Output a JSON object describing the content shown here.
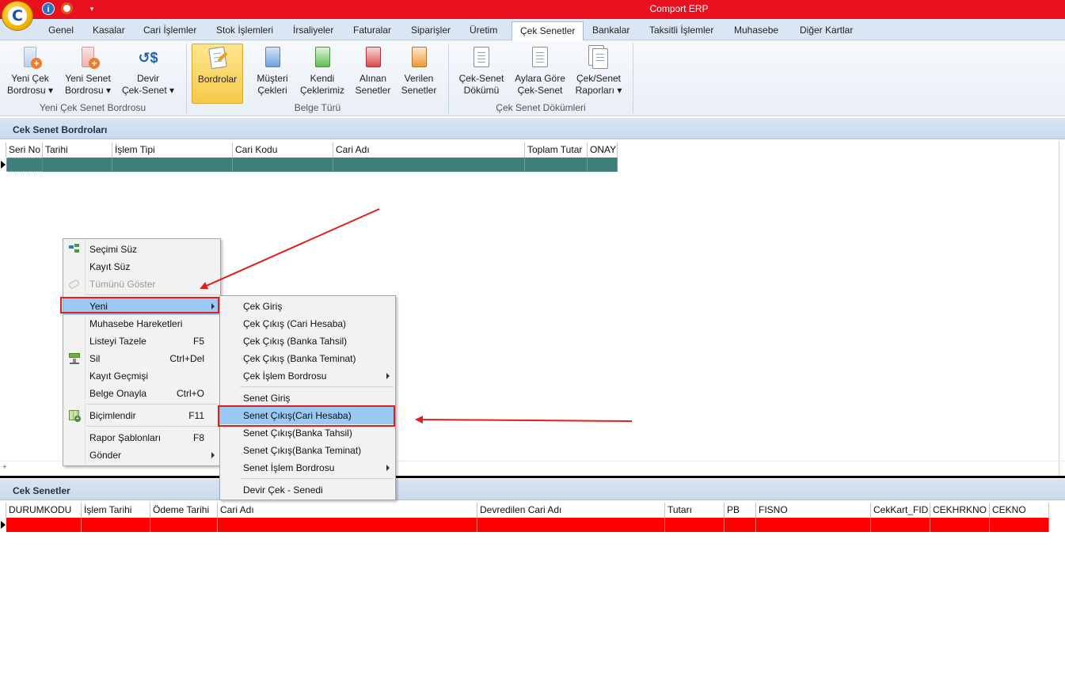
{
  "window": {
    "title": "Comport ERP"
  },
  "icons": {
    "logo": "comport-logo",
    "info": "info-icon",
    "help": "lifebuoy-icon",
    "customize": "quick-access-dropdown-icon"
  },
  "tabs": [
    "Genel",
    "Kasalar",
    "Cari İşlemler",
    "Stok İşlemleri",
    "İrsaliyeler",
    "Faturalar",
    "Siparişler",
    "Üretim",
    "Çek Senetler",
    "Bankalar",
    "Taksitli İşlemler",
    "Muhasebe",
    "Diğer Kartlar"
  ],
  "active_tab": "Çek Senetler",
  "ribbon": {
    "new_cheque_payroll": [
      "Yeni Çek",
      "Bordrosu ▾"
    ],
    "new_bond_payroll": [
      "Yeni Senet",
      "Bordrosu ▾"
    ],
    "transfer": [
      "Devir",
      "Çek-Senet ▾"
    ],
    "group1_label": "Yeni Çek Senet Bordrosu",
    "payrolls": "Bordrolar",
    "customer_cheques": [
      "Müşteri",
      "Çekleri"
    ],
    "own_cheques": [
      "Kendi",
      "Çeklerimiz"
    ],
    "received_bonds": [
      "Alınan",
      "Senetler"
    ],
    "given_bonds": [
      "Verilen",
      "Senetler"
    ],
    "group2_label": "Belge Türü",
    "listing": [
      "Çek-Senet",
      "Dökümü"
    ],
    "monthly": [
      "Aylara Göre",
      "Çek-Senet"
    ],
    "reports": [
      "Çek/Senet",
      "Raporları ▾"
    ],
    "group3_label": "Çek Senet Dökümleri"
  },
  "top_panel": {
    "title": "Cek Senet Bordroları",
    "columns": [
      "Seri No",
      "Tarihi",
      "İşlem Tipi",
      "Cari Kodu",
      "Cari Adı",
      "Toplam Tutar",
      "ONAY"
    ],
    "row_color": "#3f7f7a"
  },
  "bottom_panel": {
    "title": "Cek Senetler",
    "columns": [
      "DURUMKODU",
      "İşlem Tarihi",
      "Ödeme Tarihi",
      "Cari Adı",
      "Devredilen Cari Adı",
      "Tutarı",
      "PB",
      "FISNO",
      "CekKart_FID",
      "CEKHRKNO",
      "CEKNO"
    ],
    "row_color": "#ff0000"
  },
  "context_menu": {
    "items": [
      {
        "label": "Seçimi Süz",
        "shortcut": ""
      },
      {
        "label": "Kayıt Süz",
        "shortcut": ""
      },
      {
        "label": "Tümünü Göster",
        "shortcut": ""
      },
      {
        "label": "Yeni",
        "shortcut": ""
      },
      {
        "label": "Muhasebe Hareketleri",
        "shortcut": ""
      },
      {
        "label": "Listeyi Tazele",
        "shortcut": "F5"
      },
      {
        "label": "Sil",
        "shortcut": "Ctrl+Del"
      },
      {
        "label": "Kayıt Geçmişi",
        "shortcut": ""
      },
      {
        "label": "Belge Onayla",
        "shortcut": "Ctrl+O"
      },
      {
        "label": "Biçimlendir",
        "shortcut": "F11"
      },
      {
        "label": "Rapor Şablonları",
        "shortcut": "F8"
      },
      {
        "label": "Gönder",
        "shortcut": ""
      }
    ]
  },
  "submenu": {
    "items": [
      "Çek Giriş",
      "Çek Çıkış (Cari Hesaba)",
      "Çek Çıkış (Banka Tahsil)",
      "Çek Çıkış (Banka Teminat)",
      "Çek İşlem Bordrosu",
      "Senet Giriş",
      "Senet Çıkış(Cari Hesaba)",
      "Senet Çıkış(Banka Tahsil)",
      "Senet Çıkış(Banka Teminat)",
      "Senet İşlem Bordrosu",
      "Devir Çek - Senedi"
    ]
  },
  "colors": {
    "titlebar": "#e8101e",
    "highlight": "#99c9f4",
    "annotation": "#e21d1d"
  }
}
